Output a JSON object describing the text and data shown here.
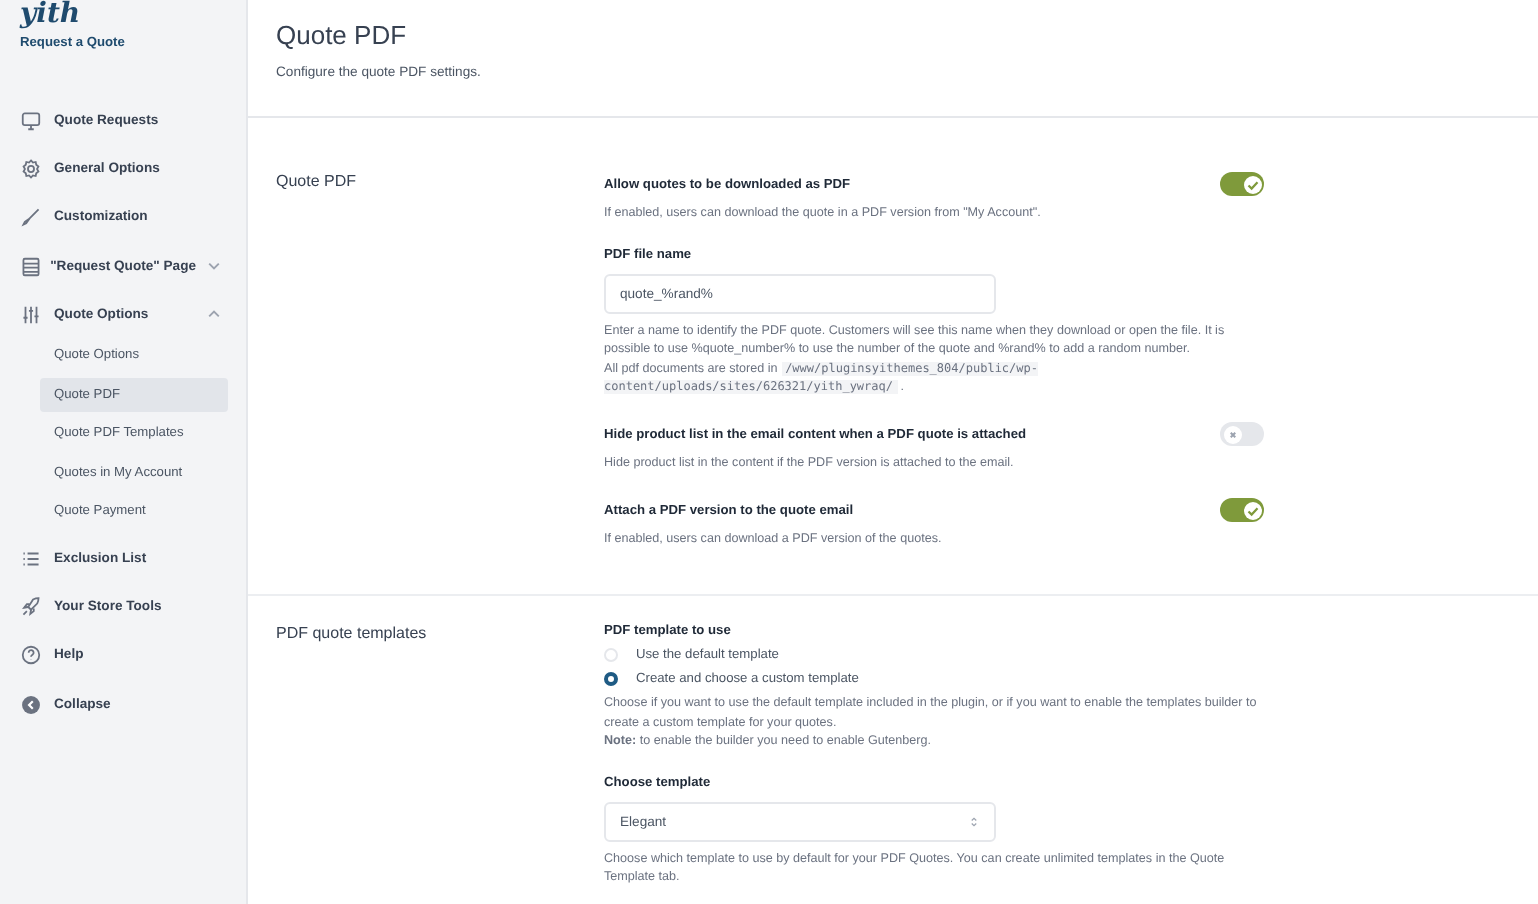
{
  "sidebar": {
    "logo": "yith",
    "subtitle": "Request a Quote",
    "items": [
      {
        "label": "Quote Requests",
        "selected": false
      },
      {
        "label": "General Options",
        "selected": false
      },
      {
        "label": "Customization",
        "selected": false
      },
      {
        "label": "\"Request Quote\" Page",
        "selected": false,
        "expanded": false
      },
      {
        "label": "Quote Options",
        "selected": false,
        "expanded": true,
        "children": [
          {
            "label": "Quote Options",
            "selected": false
          },
          {
            "label": "Quote PDF",
            "selected": true
          },
          {
            "label": "Quote PDF Templates",
            "selected": false
          },
          {
            "label": "Quotes in My Account",
            "selected": false
          },
          {
            "label": "Quote Payment",
            "selected": false
          }
        ]
      },
      {
        "label": "Exclusion List",
        "selected": false
      },
      {
        "label": "Your Store Tools",
        "selected": false
      },
      {
        "label": "Help",
        "selected": false
      },
      {
        "label": "Collapse",
        "selected": false
      }
    ]
  },
  "header": {
    "title": "Quote PDF",
    "description": "Configure the quote PDF settings."
  },
  "sections": [
    {
      "title": "Quote PDF",
      "settings": [
        {
          "kind": "toggle",
          "label": "Allow quotes to be downloaded as PDF",
          "on": true,
          "description": "If enabled, users can download the quote in a PDF version from \"My Account\"."
        },
        {
          "kind": "text",
          "label": "PDF file name",
          "value": "quote_%rand%",
          "description": "Enter a name to identify the PDF quote. Customers will see this name when they download or open the file. It is possible to use %quote_number% to use the number of the quote and %rand% to add a random number.",
          "note_start": "All pdf documents are stored in",
          "path": "/www/pluginsyithemes_804/public/wp-content/uploads/sites/626321/yith_ywraq/",
          "note_end": "."
        },
        {
          "kind": "toggle",
          "label": "Hide product list in the email content when a PDF quote is attached",
          "on": false,
          "description": "Hide product list in the content if the PDF version is attached to the email."
        },
        {
          "kind": "toggle",
          "label": "Attach a PDF version to the quote email",
          "on": true,
          "description": "If enabled, users can download a PDF version of the quotes."
        }
      ]
    },
    {
      "title": "PDF quote templates",
      "settings": [
        {
          "kind": "radio",
          "label": "PDF template to use",
          "options": [
            {
              "label": "Use the default template",
              "selected": false
            },
            {
              "label": "Create and choose a custom template",
              "selected": true
            }
          ],
          "description": "Choose if you want to use the default template included in the plugin, or if you want to enable the templates builder to create a custom template for your quotes.",
          "note": "**Note:** to enable the builder you need to enable Gutenberg."
        },
        {
          "kind": "select",
          "label": "Choose template",
          "value": "Elegant",
          "description": "Choose which template to use by default for your PDF Quotes. You can create unlimited templates in the Quote Template tab."
        }
      ]
    }
  ]
}
